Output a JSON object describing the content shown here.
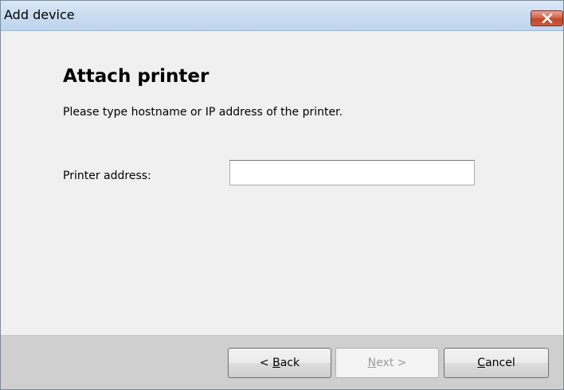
{
  "window": {
    "title": "Add device",
    "close_icon": "close-icon"
  },
  "page": {
    "heading": "Attach printer",
    "instructions": "Please type hostname or IP address of the printer."
  },
  "form": {
    "address_label": "Printer address:",
    "address_value": "",
    "address_placeholder": ""
  },
  "buttons": {
    "back": {
      "prefix": "< ",
      "accel": "B",
      "rest": "ack",
      "enabled": true
    },
    "next": {
      "prefix": "",
      "accel": "N",
      "rest": "ext >",
      "enabled": false
    },
    "cancel": {
      "prefix": "",
      "accel": "C",
      "rest": "ancel",
      "enabled": true
    }
  },
  "colors": {
    "titlebar": "#c9dcf1",
    "close_button": "#c0452a",
    "background": "#f0f0f0",
    "footer": "#cfcfcf"
  }
}
